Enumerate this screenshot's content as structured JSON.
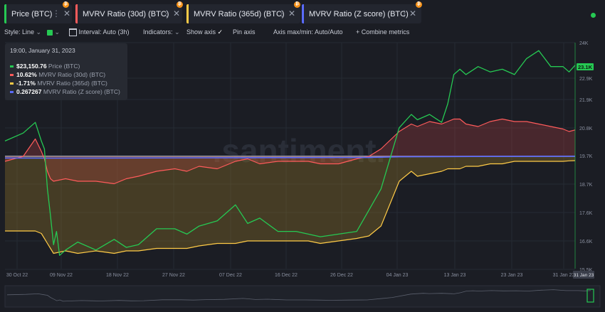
{
  "tabs": [
    {
      "label": "Price (BTC)",
      "color": "#26c953",
      "icon": "bitcoin-icon"
    },
    {
      "label": "MVRV Ratio (30d) (BTC)",
      "color": "#ff5b5b",
      "icon": "bitcoin-icon"
    },
    {
      "label": "MVRV Ratio (365d) (BTC)",
      "color": "#ffcb47",
      "icon": "bitcoin-icon"
    },
    {
      "label": "MVRV Ratio (Z score) (BTC)",
      "color": "#5a6bff",
      "icon": "bitcoin-icon"
    }
  ],
  "toolbar": {
    "style_label": "Style: Line",
    "interval_label": "Interval: Auto (3h)",
    "indicators_label": "Indicators:",
    "show_axis_label": "Show axis",
    "pin_axis_label": "Pin axis",
    "axis_range_label": "Axis max/min: Auto/Auto",
    "combine_label": "+ Combine metrics",
    "line_color": "#26c953"
  },
  "tooltip": {
    "date": "19:00, January 31, 2023",
    "rows": [
      {
        "value": "$23,150.76",
        "name": "Price (BTC)",
        "color": "#26c953"
      },
      {
        "value": "10.62%",
        "name": "MVRV Ratio (30d) (BTC)",
        "color": "#ff5b5b"
      },
      {
        "value": "-1.71%",
        "name": "MVRV Ratio (365d) (BTC)",
        "color": "#ffcb47"
      },
      {
        "value": "0.267267",
        "name": "MVRV Ratio (Z score) (BTC)",
        "color": "#5a6bff"
      }
    ]
  },
  "watermark": ".santiment.",
  "chart_data": {
    "type": "line",
    "x_ticks": [
      "30 Oct 22",
      "09 Nov 22",
      "18 Nov 22",
      "27 Nov 22",
      "07 Dec 22",
      "16 Dec 22",
      "26 Dec 22",
      "04 Jan 23",
      "13 Jan 23",
      "23 Jan 23",
      "31 Jan 23"
    ],
    "y_ticks": [
      "24K",
      "23.1K",
      "22.9K",
      "21.9K",
      "20.8K",
      "19.7K",
      "18.7K",
      "17.6K",
      "16.6K",
      "15.5K"
    ],
    "current_price_label": "23.1K",
    "ylim": [
      15500,
      24000
    ],
    "series": [
      {
        "name": "Price (BTC)",
        "color": "#26c953",
        "x": [
          0,
          3,
          5,
          6,
          6.5,
          7,
          7.5,
          8,
          8.5,
          9,
          10,
          12,
          15,
          18,
          20,
          22,
          25,
          28,
          30,
          32,
          35,
          38,
          40,
          42,
          45,
          48,
          50,
          52,
          55,
          58,
          60,
          62,
          65,
          67,
          68,
          70,
          72,
          73,
          74,
          75,
          76,
          78,
          80,
          82,
          84,
          86,
          88,
          90,
          92,
          93,
          94
        ],
        "values": [
          20300,
          20600,
          21000,
          20300,
          20000,
          18500,
          17500,
          16400,
          16900,
          16000,
          16200,
          16500,
          16200,
          16600,
          16300,
          16400,
          17000,
          17000,
          16800,
          17100,
          17300,
          17900,
          17200,
          17400,
          16900,
          16900,
          16800,
          16700,
          16800,
          16900,
          17700,
          18500,
          20800,
          21300,
          21100,
          21300,
          21000,
          21700,
          22800,
          23000,
          22800,
          23100,
          22900,
          23000,
          22800,
          23400,
          23700,
          23100,
          23100,
          22900,
          23150
        ]
      },
      {
        "name": "MVRV Ratio (30d) (BTC)",
        "color": "#ff5b5b",
        "x": [
          0,
          3,
          5,
          6,
          6.5,
          7,
          7.5,
          8,
          10,
          12,
          15,
          18,
          20,
          22,
          25,
          28,
          30,
          32,
          35,
          38,
          40,
          42,
          45,
          48,
          50,
          52,
          55,
          58,
          60,
          62,
          65,
          67,
          68,
          70,
          72,
          73,
          74,
          75,
          76,
          78,
          80,
          82,
          84,
          86,
          88,
          90,
          92,
          93,
          94
        ],
        "values": [
          -2,
          0,
          7,
          2,
          -1,
          -6,
          -9,
          -10,
          -9,
          -10,
          -10,
          -11,
          -9,
          -8,
          -6,
          -5,
          -6,
          -4,
          -5,
          -2,
          -1,
          -3,
          -2,
          -2,
          -2,
          -3,
          -3,
          -1,
          0,
          3,
          10,
          13,
          12,
          14,
          13,
          14,
          15,
          15,
          13,
          12,
          14,
          15,
          14,
          14,
          13,
          12,
          11,
          10,
          10.62
        ]
      },
      {
        "name": "MVRV Ratio (365d) (BTC)",
        "color": "#ffcb47",
        "x": [
          0,
          3,
          5,
          6,
          6.5,
          7,
          7.5,
          8,
          10,
          12,
          15,
          18,
          20,
          22,
          25,
          28,
          30,
          32,
          35,
          38,
          40,
          42,
          45,
          48,
          50,
          52,
          55,
          58,
          60,
          62,
          65,
          67,
          68,
          70,
          72,
          73,
          74,
          75,
          76,
          78,
          80,
          82,
          84,
          86,
          88,
          90,
          92,
          93,
          94
        ],
        "values": [
          -30,
          -30,
          -30,
          -31,
          -33,
          -35,
          -37,
          -39,
          -38,
          -39,
          -38,
          -39,
          -38,
          -38,
          -37,
          -37,
          -37,
          -36,
          -35,
          -35,
          -34,
          -34,
          -34,
          -34,
          -34,
          -35,
          -34,
          -33,
          -32,
          -28,
          -10,
          -6,
          -8,
          -7,
          -6,
          -5,
          -5,
          -5,
          -4,
          -4,
          -3,
          -3,
          -2,
          -2,
          -2,
          -2,
          -2,
          -1.8,
          -1.71
        ]
      },
      {
        "name": "MVRV Ratio (Z score) (BTC)",
        "color": "#5a6bff",
        "x": [
          0,
          8,
          20,
          40,
          60,
          65,
          70,
          80,
          90,
          94
        ],
        "values": [
          0.06,
          0.04,
          0.06,
          0.09,
          0.12,
          0.2,
          0.22,
          0.24,
          0.26,
          0.267267
        ]
      }
    ]
  }
}
